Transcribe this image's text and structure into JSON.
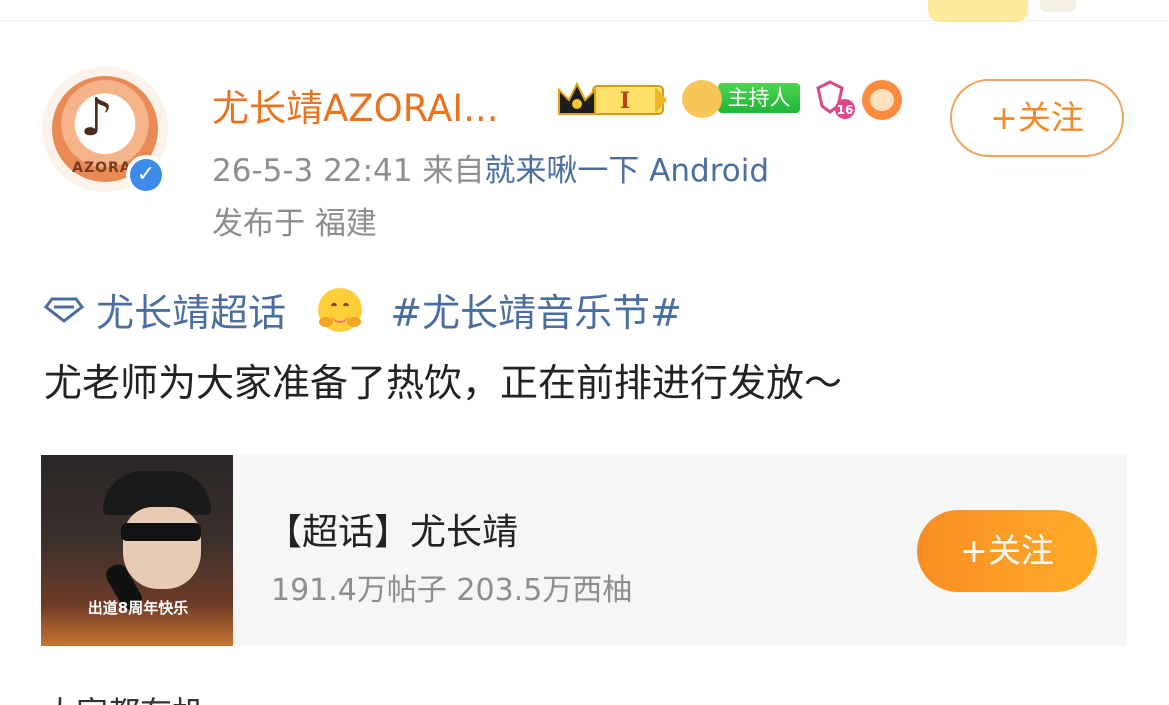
{
  "post": {
    "username": "尤长靖AZORAI...",
    "time": "26-5-3 22:41",
    "source_prefix": "来自",
    "source": "就来啾一下 Android",
    "location": "发布于 福建",
    "follow_label": "+关注",
    "badges": {
      "level": "I",
      "host": "主持人",
      "number": "16"
    },
    "avatar_text": "AZORAI"
  },
  "content": {
    "supertopic": "尤长靖超话",
    "hashtag": "#尤长靖音乐节#",
    "text": "尤老师为大家准备了热饮，正在前排进行发放～"
  },
  "card": {
    "title": "【超话】尤长靖",
    "stats": "191.4万帖子 203.5万西柚",
    "follow_label": "+关注",
    "image_banner": "出道8周年快乐"
  },
  "truncated_next_line": "大家都有机",
  "colors": {
    "orange": "#e9731f",
    "link_blue": "#4a6ea0",
    "gray": "#8e8e8e",
    "host_green": "#20b53a"
  },
  "icons": [
    "crown-level-icon",
    "host-badge-icon",
    "heart-16-icon",
    "sun-badge-icon",
    "verified-icon",
    "supertopic-diamond-icon",
    "hug-emoji-icon"
  ]
}
